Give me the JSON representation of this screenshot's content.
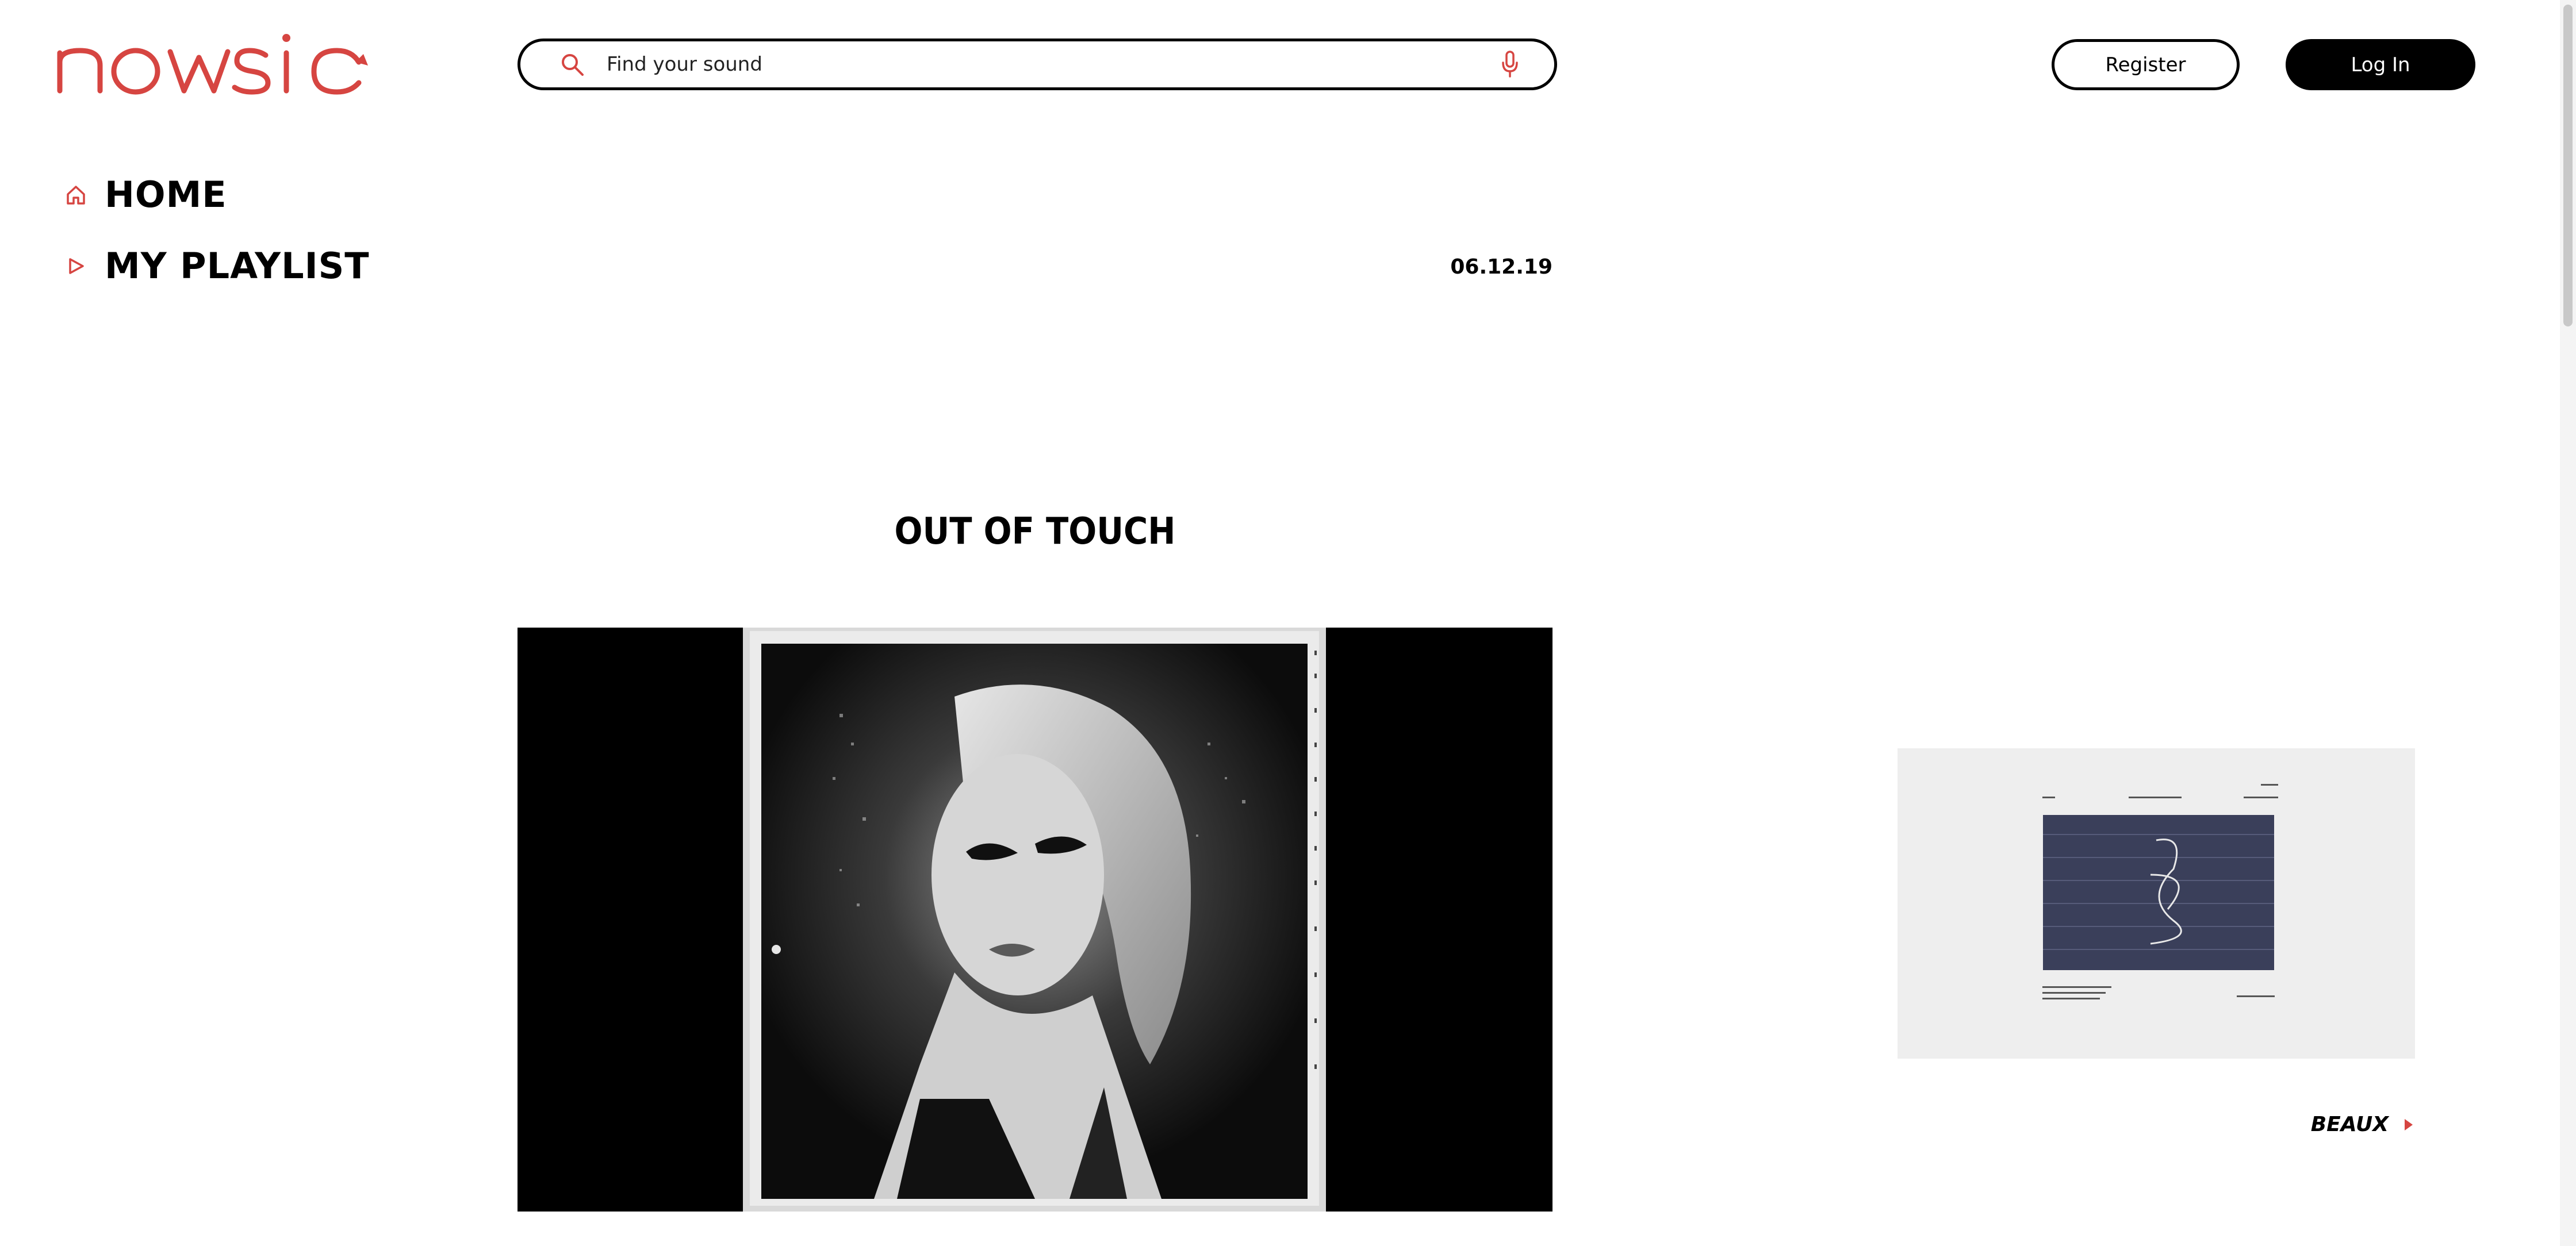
{
  "brand": {
    "logo_text": "nowsic",
    "accent_color": "#d64541"
  },
  "search": {
    "placeholder": "Find your sound",
    "value": "",
    "icon": "search-icon",
    "voice_icon": "microphone-icon"
  },
  "auth": {
    "register_label": "Register",
    "login_label": "Log In"
  },
  "nav": {
    "items": [
      {
        "label": "HOME",
        "icon": "home-icon"
      },
      {
        "label": "MY PLAYLIST",
        "icon": "play-triangle-icon"
      }
    ]
  },
  "post": {
    "date": "06.12.19",
    "title": "OUT OF TOUCH"
  },
  "sidebar_card": {
    "caption": "BEAUX",
    "icon": "arrow-right-icon"
  }
}
